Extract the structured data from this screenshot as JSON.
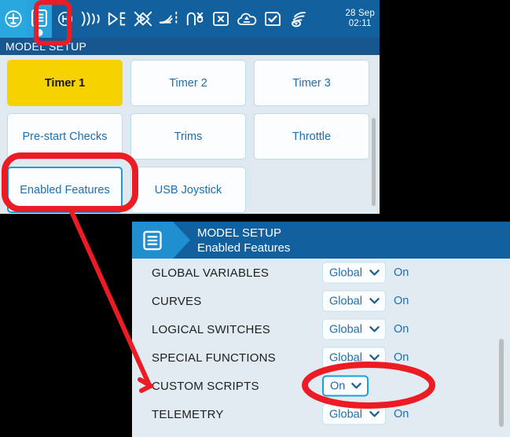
{
  "colors": {
    "header_blue": "#12619e",
    "accent_blue": "#1f8fd0",
    "selected_yellow": "#f6d200",
    "tile_text": "#1f6fae",
    "annotation_red": "#ed1c24",
    "focus_outline": "#16a0e0",
    "panel_bg": "#e2ebf1"
  },
  "top_screen": {
    "statusbar": {
      "icons": [
        {
          "name": "model-plane-icon",
          "glyph": "plane-in-circle"
        },
        {
          "name": "model-setup-icon",
          "glyph": "document-lines",
          "selected": true
        },
        {
          "name": "heli-setup-icon",
          "glyph": "h-in-circle"
        },
        {
          "name": "flight-modes-icon",
          "glyph": "sound-waves"
        },
        {
          "name": "inputs-icon",
          "glyph": "inputs-arrow"
        },
        {
          "name": "mixer-icon",
          "glyph": "mixer-cross"
        },
        {
          "name": "outputs-icon",
          "glyph": "outputs-curve"
        },
        {
          "name": "curves-icon",
          "glyph": "curve-node"
        },
        {
          "name": "logical-switches-icon",
          "glyph": "x-box"
        },
        {
          "name": "special-functions-icon",
          "glyph": "function-cloud"
        },
        {
          "name": "custom-scripts-icon",
          "glyph": "check-box"
        },
        {
          "name": "telemetry-icon",
          "glyph": "telemetry-eye"
        }
      ],
      "clock": {
        "date": "28 Sep",
        "time": "02:11"
      }
    },
    "page_title": "MODEL SETUP",
    "tiles": [
      {
        "label": "Timer 1",
        "state": "selected"
      },
      {
        "label": "Timer 2",
        "state": "normal"
      },
      {
        "label": "Timer 3",
        "state": "normal"
      },
      {
        "label": "Pre-start Checks",
        "state": "normal"
      },
      {
        "label": "Trims",
        "state": "normal"
      },
      {
        "label": "Throttle",
        "state": "normal"
      },
      {
        "label": "Enabled Features",
        "state": "focus"
      },
      {
        "label": "USB Joystick",
        "state": "normal"
      }
    ]
  },
  "panel": {
    "header_icon": "document-lines-icon",
    "title": "MODEL SETUP",
    "subtitle": "Enabled Features",
    "rows": [
      {
        "label": "GLOBAL VARIABLES",
        "value": "Global",
        "state": "On",
        "active": false
      },
      {
        "label": "CURVES",
        "value": "Global",
        "state": "On",
        "active": false
      },
      {
        "label": "LOGICAL SWITCHES",
        "value": "Global",
        "state": "On",
        "active": false
      },
      {
        "label": "SPECIAL FUNCTIONS",
        "value": "Global",
        "state": "On",
        "active": false
      },
      {
        "label": "CUSTOM SCRIPTS",
        "value": "On",
        "state": "",
        "active": true
      },
      {
        "label": "TELEMETRY",
        "value": "Global",
        "state": "On",
        "active": false
      }
    ]
  }
}
